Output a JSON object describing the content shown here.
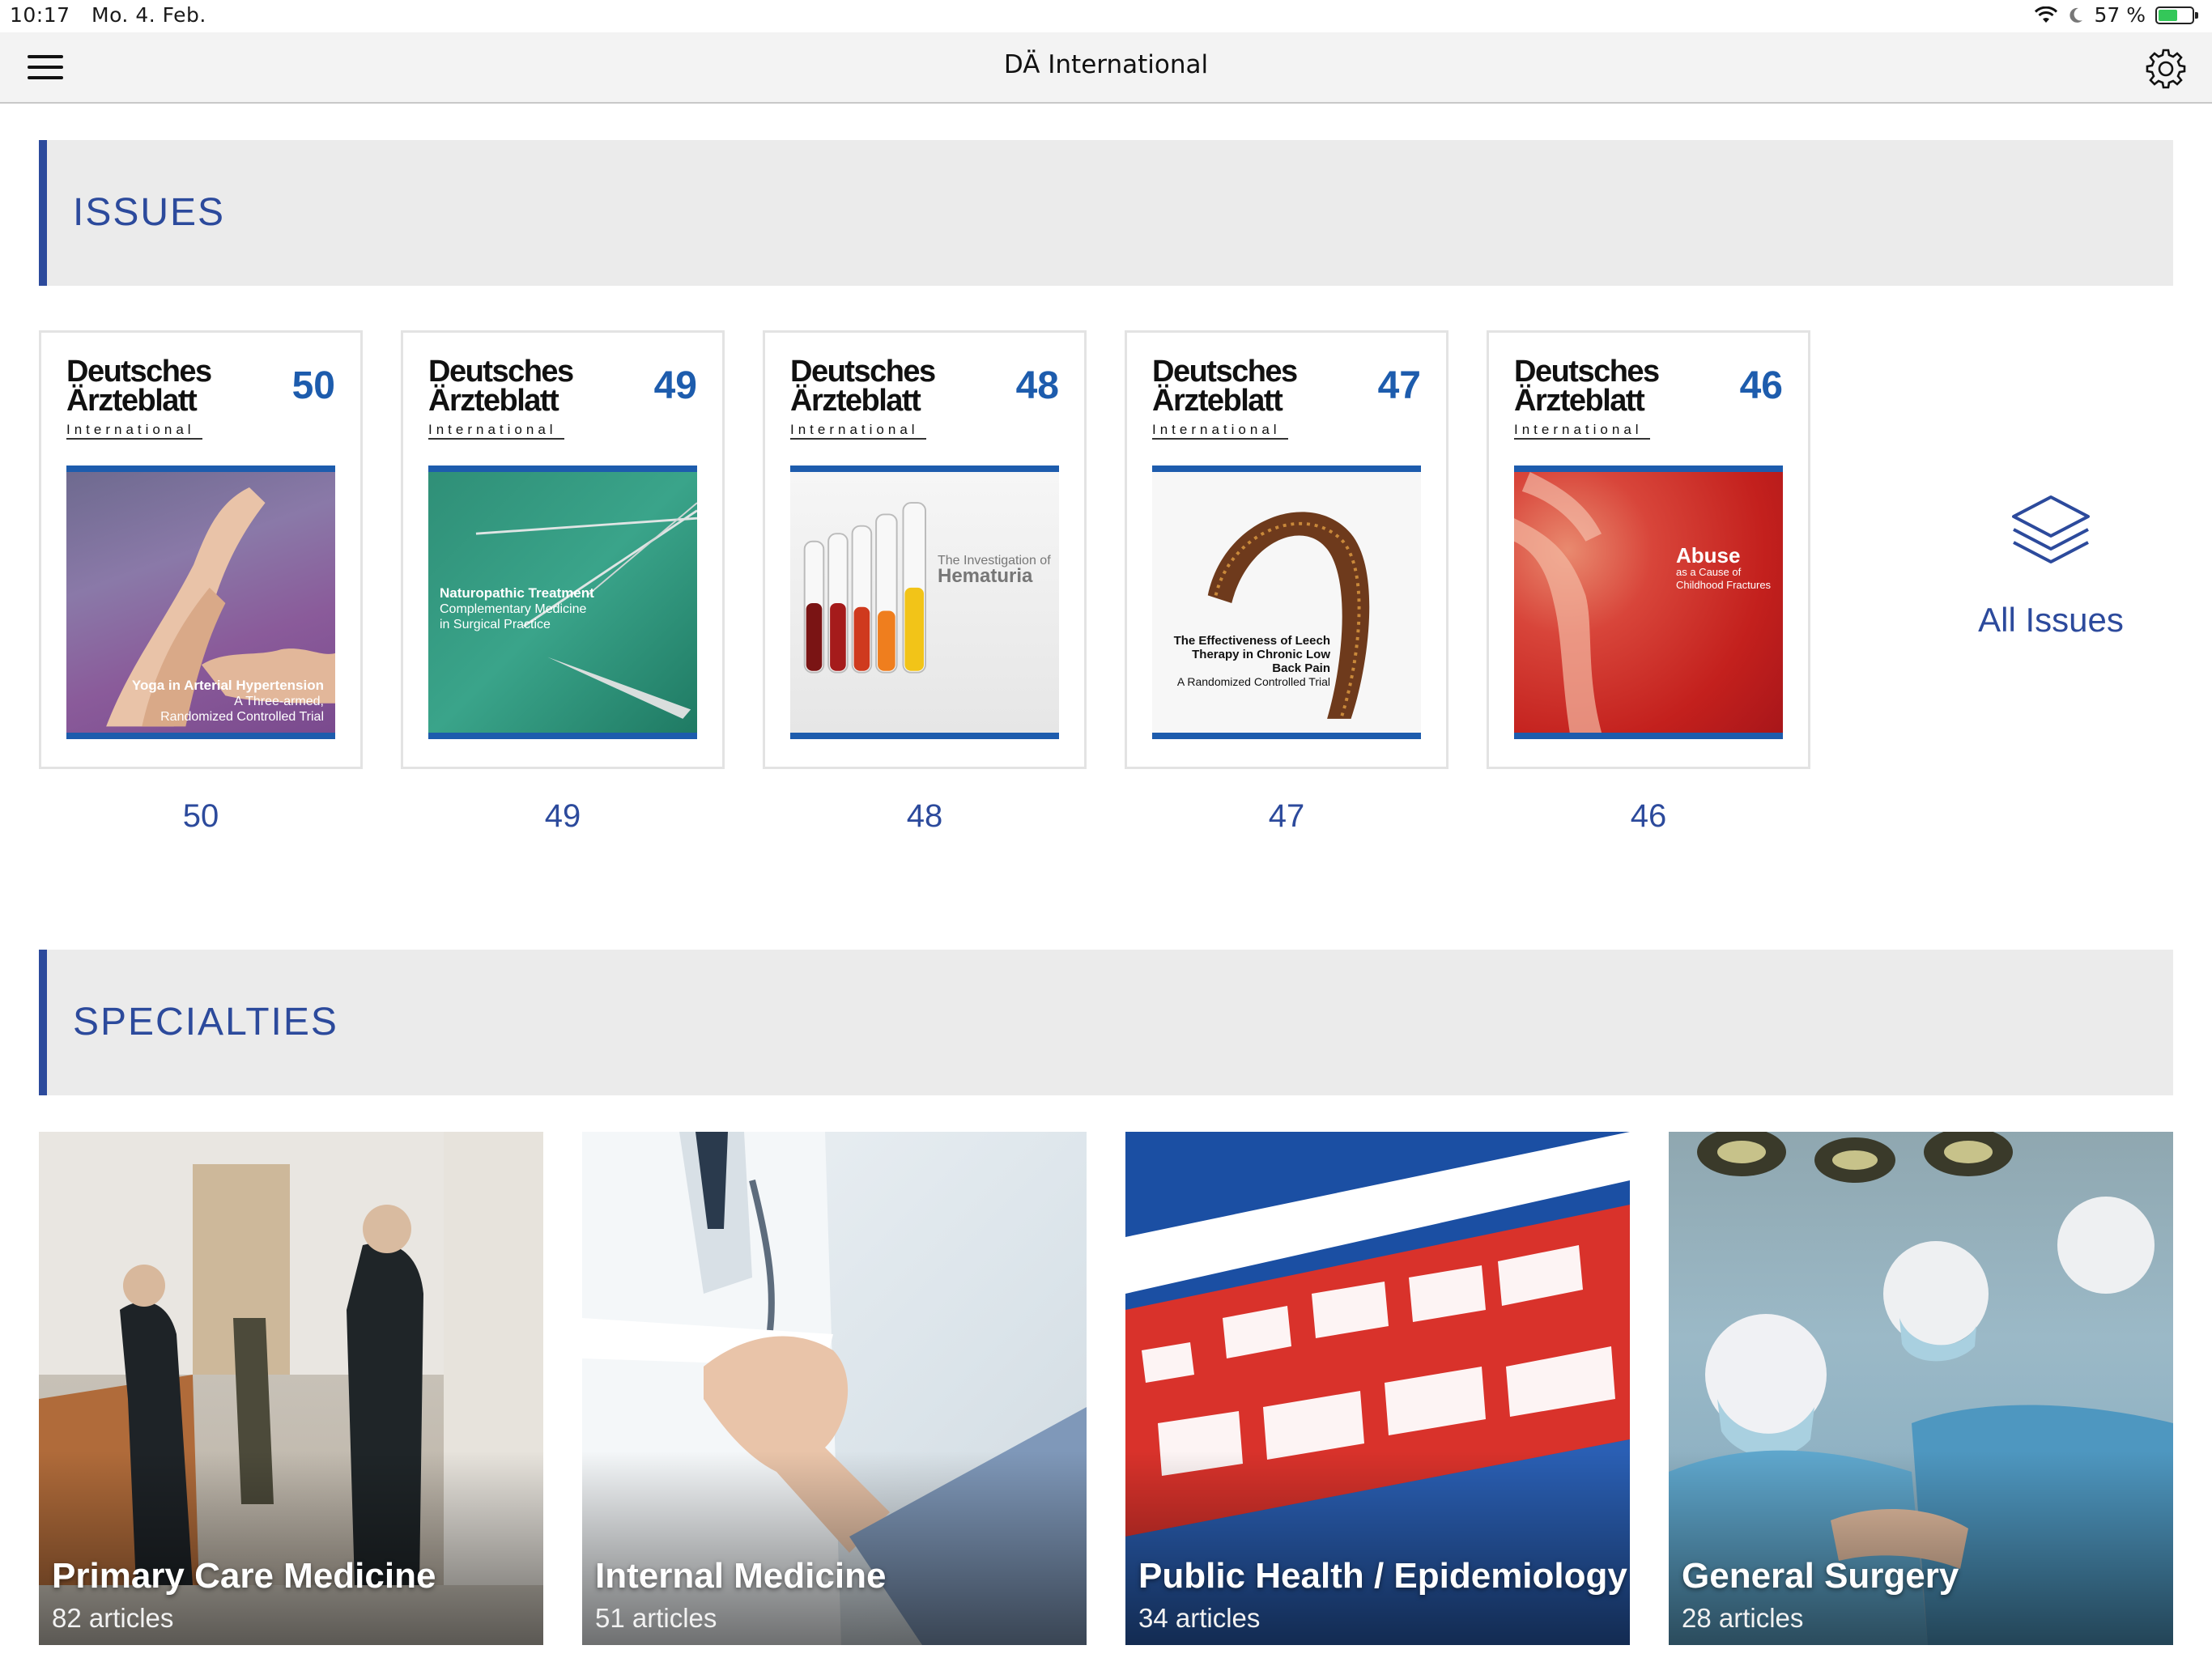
{
  "status_bar": {
    "time": "10:17",
    "date": "Mo. 4. Feb.",
    "battery": "57 %",
    "battery_level": 0.57
  },
  "nav": {
    "title": "DÄ International",
    "menu_icon": "hamburger-menu-icon",
    "settings_icon": "gear-icon"
  },
  "issues_section": {
    "label": "ISSUES"
  },
  "masthead": {
    "line1": "Deutsches",
    "line2": "Ärzteblatt",
    "line3": "International"
  },
  "issues": [
    {
      "number": "50",
      "caption": "50",
      "cover_title": "Yoga in Arterial Hypertension",
      "cover_sub1": "A Three-armed,",
      "cover_sub2": "Randomized Controlled Trial"
    },
    {
      "number": "49",
      "caption": "49",
      "cover_title": "Naturopathic Treatment",
      "cover_sub1": "Complementary Medicine",
      "cover_sub2": "in Surgical Practice"
    },
    {
      "number": "48",
      "caption": "48",
      "cover_title": "Hematuria",
      "cover_sub1": "The Investigation of",
      "cover_sub2": ""
    },
    {
      "number": "47",
      "caption": "47",
      "cover_title": "The Effectiveness of Leech Therapy in Chronic Low Back Pain",
      "cover_sub1": "A Randomized Controlled Trial",
      "cover_sub2": ""
    },
    {
      "number": "46",
      "caption": "46",
      "cover_title": "Abuse",
      "cover_sub1": "as a Cause of",
      "cover_sub2": "Childhood Fractures"
    }
  ],
  "all_issues": {
    "label": "All Issues",
    "icon": "layers-icon"
  },
  "specialties_section": {
    "label": "SPECIALTIES"
  },
  "specialties": [
    {
      "name": "Primary Care Medicine",
      "count": "82 articles"
    },
    {
      "name": "Internal Medicine",
      "count": "51 articles"
    },
    {
      "name": "Public Health / Epidemiology",
      "count": "34 articles"
    },
    {
      "name": "General Surgery",
      "count": "28 articles"
    }
  ],
  "colors": {
    "accent": "#2c4a9c",
    "issue_blue": "#1d5cad",
    "header_bg": "#ebebeb"
  }
}
